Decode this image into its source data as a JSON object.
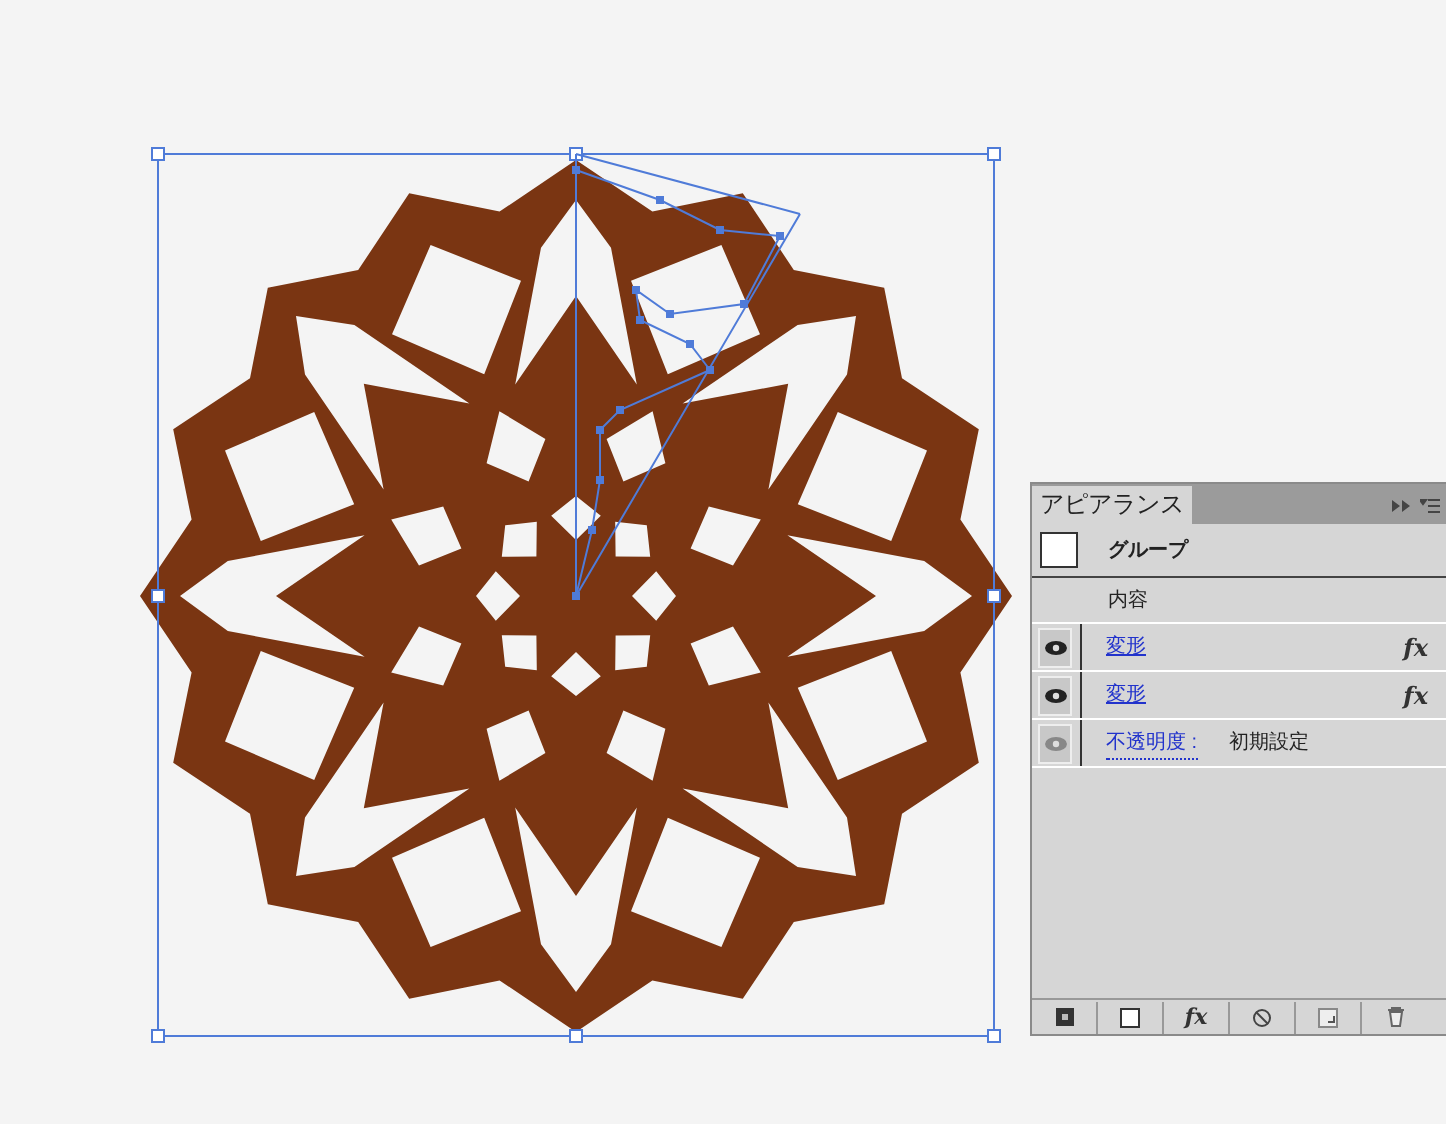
{
  "panel": {
    "title": "アピアランス",
    "target": {
      "label": "グループ"
    },
    "contents_label": "内容",
    "rows": [
      {
        "kind": "effect",
        "label": "変形",
        "fx": "fx",
        "visible": true
      },
      {
        "kind": "effect",
        "label": "変形",
        "fx": "fx",
        "visible": true
      },
      {
        "kind": "opacity",
        "label": "不透明度 :",
        "value": "初期設定",
        "visible": true
      }
    ],
    "toolbar_fx": "fx"
  }
}
